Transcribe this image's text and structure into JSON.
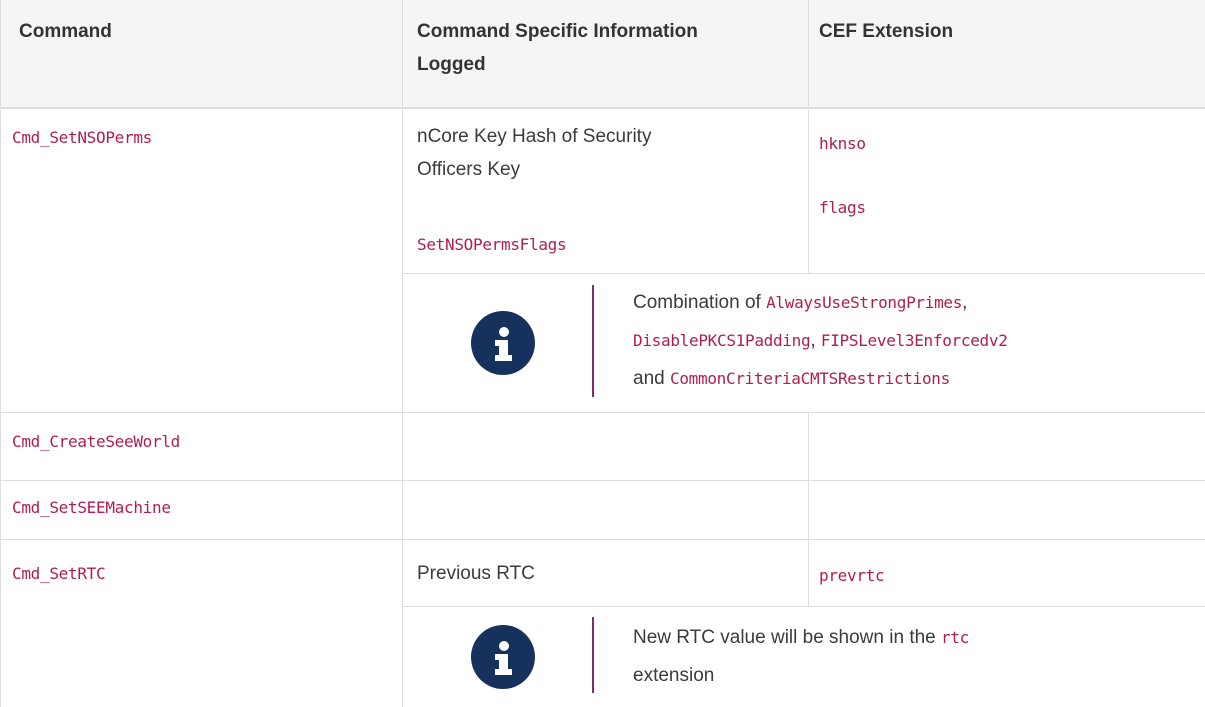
{
  "table": {
    "headers": {
      "command": "Command",
      "info_line1": "Command Specific Information",
      "info_line2": "Logged",
      "cef": "CEF Extension"
    },
    "rows": [
      {
        "command": "Cmd_SetNSOPerms",
        "info_line1": "nCore Key Hash of Security",
        "info_line2": "Officers Key",
        "info_code": "SetNSOPermsFlags",
        "cef": [
          "hknso",
          "flags"
        ],
        "note": {
          "prefix": "Combination of ",
          "code1": "AlwaysUseStrongPrimes",
          "sep1": ",",
          "code2": "DisablePKCS1Padding",
          "sep2": ", ",
          "code3": "FIPSLevel3Enforcedv2",
          "and": "and ",
          "code4": "CommonCriteriaCMTSRestrictions"
        }
      },
      {
        "command": "Cmd_CreateSeeWorld"
      },
      {
        "command": "Cmd_SetSEEMachine"
      },
      {
        "command": "Cmd_SetRTC",
        "info": "Previous RTC",
        "cef": "prevrtc",
        "note": {
          "prefix": "New RTC value will be shown in the ",
          "code": "rtc",
          "suffix": "extension"
        }
      }
    ]
  },
  "colors": {
    "code": "#b01e4f",
    "header_bg": "#f5f5f5",
    "border": "#dedede",
    "icon_bg": "#16325c",
    "note_bar": "#7b2d6e"
  },
  "icons": [
    "info-icon"
  ]
}
